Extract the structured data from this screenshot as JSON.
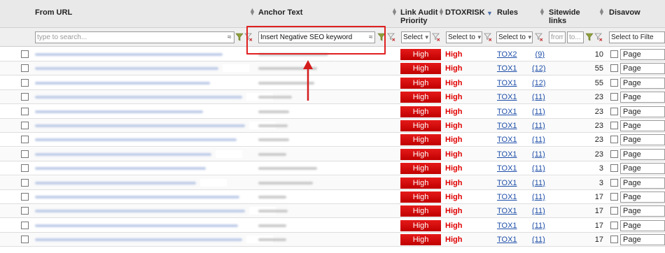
{
  "header": {
    "from_url": "From URL",
    "anchor_text": "Anchor Text",
    "link_audit_priority_1": "Link Audit",
    "link_audit_priority_2": "Priority",
    "dtoxrisk": "DTOXRISK",
    "rules": "Rules",
    "sitewide_links_1": "Sitewide",
    "sitewide_links_2": "links",
    "disavow": "Disavow"
  },
  "filters": {
    "from_url_placeholder": "type to search...",
    "anchor_value": "Insert Negative SEO keyword",
    "approx_symbol": "≈",
    "priority_select": "Select",
    "dtox_select": "Select to",
    "rules_select": "Select to",
    "sitewide_from": "from",
    "sitewide_to": "to...",
    "disavow_select": "Select to Filte"
  },
  "colors": {
    "high_badge": "#d40f0f",
    "dtox_text": "#e00000",
    "link": "#1f4fa8",
    "annotation": "#e02020"
  },
  "rows": [
    {
      "priority": "High",
      "dtox": "High",
      "rule": "TOX2",
      "rule_count": "(9)",
      "sitewide": "10",
      "disavow": "Page"
    },
    {
      "priority": "High",
      "dtox": "High",
      "rule": "TOX1",
      "rule_count": "(12)",
      "sitewide": "55",
      "disavow": "Page"
    },
    {
      "priority": "High",
      "dtox": "High",
      "rule": "TOX1",
      "rule_count": "(12)",
      "sitewide": "55",
      "disavow": "Page"
    },
    {
      "priority": "High",
      "dtox": "High",
      "rule": "TOX1",
      "rule_count": "(11)",
      "sitewide": "23",
      "disavow": "Page"
    },
    {
      "priority": "High",
      "dtox": "High",
      "rule": "TOX1",
      "rule_count": "(11)",
      "sitewide": "23",
      "disavow": "Page"
    },
    {
      "priority": "High",
      "dtox": "High",
      "rule": "TOX1",
      "rule_count": "(11)",
      "sitewide": "23",
      "disavow": "Page"
    },
    {
      "priority": "High",
      "dtox": "High",
      "rule": "TOX1",
      "rule_count": "(11)",
      "sitewide": "23",
      "disavow": "Page"
    },
    {
      "priority": "High",
      "dtox": "High",
      "rule": "TOX1",
      "rule_count": "(11)",
      "sitewide": "23",
      "disavow": "Page"
    },
    {
      "priority": "High",
      "dtox": "High",
      "rule": "TOX1",
      "rule_count": "(11)",
      "sitewide": "3",
      "disavow": "Page"
    },
    {
      "priority": "High",
      "dtox": "High",
      "rule": "TOX1",
      "rule_count": "(11)",
      "sitewide": "3",
      "disavow": "Page"
    },
    {
      "priority": "High",
      "dtox": "High",
      "rule": "TOX1",
      "rule_count": "(11)",
      "sitewide": "17",
      "disavow": "Page"
    },
    {
      "priority": "High",
      "dtox": "High",
      "rule": "TOX1",
      "rule_count": "(11)",
      "sitewide": "17",
      "disavow": "Page"
    },
    {
      "priority": "High",
      "dtox": "High",
      "rule": "TOX1",
      "rule_count": "(11)",
      "sitewide": "17",
      "disavow": "Page"
    },
    {
      "priority": "High",
      "dtox": "High",
      "rule": "TOX1",
      "rule_count": "(11)",
      "sitewide": "17",
      "disavow": "Page"
    }
  ]
}
